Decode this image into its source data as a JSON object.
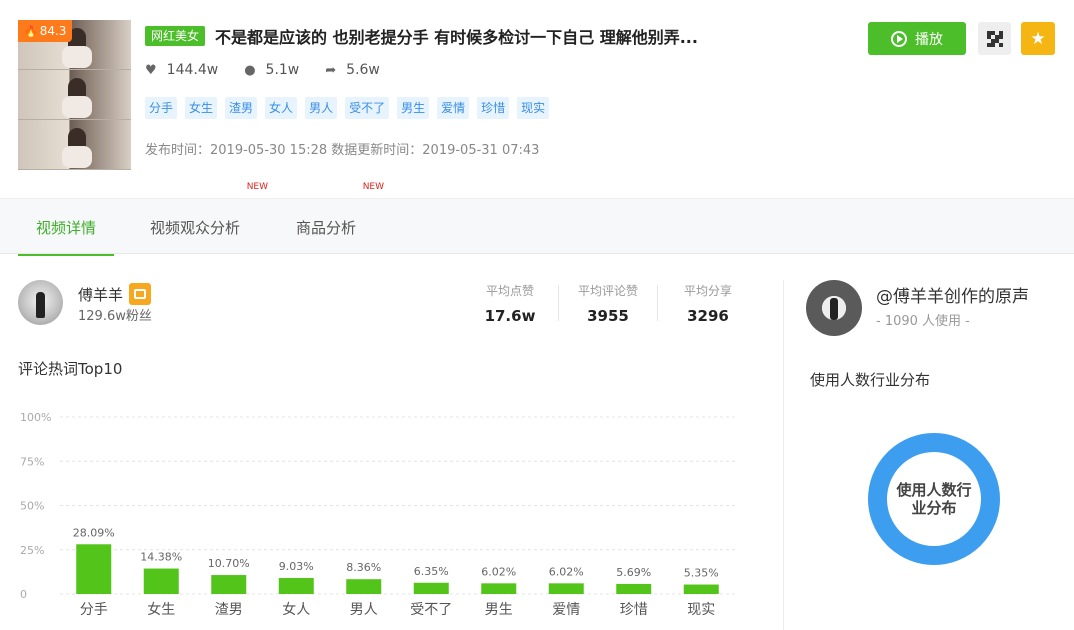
{
  "video": {
    "score": "84.3",
    "category_tag": "网红美女",
    "title": "不是都是应该的 也别老提分手 有时候多检讨一下自己 理解他别弄...",
    "likes": "144.4w",
    "comments": "5.1w",
    "shares": "5.6w",
    "keywords": [
      "分手",
      "女生",
      "渣男",
      "女人",
      "男人",
      "受不了",
      "男生",
      "爱情",
      "珍惜",
      "现实"
    ],
    "publish_time": "发布时间：2019-05-30 15:28  数据更新时间：2019-05-31 07:43"
  },
  "actions": {
    "play_label": "播放"
  },
  "tabs": [
    {
      "label": "视频详情",
      "new": ""
    },
    {
      "label": "视频观众分析",
      "new": "NEW"
    },
    {
      "label": "商品分析",
      "new": "NEW"
    }
  ],
  "author": {
    "name": "傅羊羊",
    "fans": "129.6w粉丝"
  },
  "averages": [
    {
      "label": "平均点赞",
      "value": "17.6w"
    },
    {
      "label": "平均评论赞",
      "value": "3955"
    },
    {
      "label": "平均分享",
      "value": "3296"
    }
  ],
  "comment_section": {
    "title": "评论热词Top10"
  },
  "chart_data": {
    "type": "bar",
    "title": "评论热词Top10",
    "categories": [
      "分手",
      "女生",
      "渣男",
      "女人",
      "男人",
      "受不了",
      "男生",
      "爱情",
      "珍惜",
      "现实"
    ],
    "values": [
      28.09,
      14.38,
      10.7,
      9.03,
      8.36,
      6.35,
      6.02,
      6.02,
      5.69,
      5.35
    ],
    "value_labels": [
      "28.09%",
      "14.38%",
      "10.70%",
      "9.03%",
      "8.36%",
      "6.35%",
      "6.02%",
      "6.02%",
      "5.69%",
      "5.35%"
    ],
    "ytick_labels": [
      "100%",
      "75%",
      "50%",
      "25%",
      "0"
    ],
    "yticks": [
      100,
      75,
      50,
      25,
      0
    ],
    "ylim": [
      0,
      100
    ],
    "grid": true,
    "bar_color": "#52c41a"
  },
  "music": {
    "name": "@傅羊羊创作的原声",
    "usage": "- 1090 人使用 -"
  },
  "industry": {
    "title": "使用人数行业分布",
    "donut_label": "使用人数行业分布",
    "color": "#3d9ef0"
  },
  "colors": {
    "accent_green": "#4cbe2a",
    "favorite": "#f5b614",
    "score": "#ff7a1a"
  }
}
